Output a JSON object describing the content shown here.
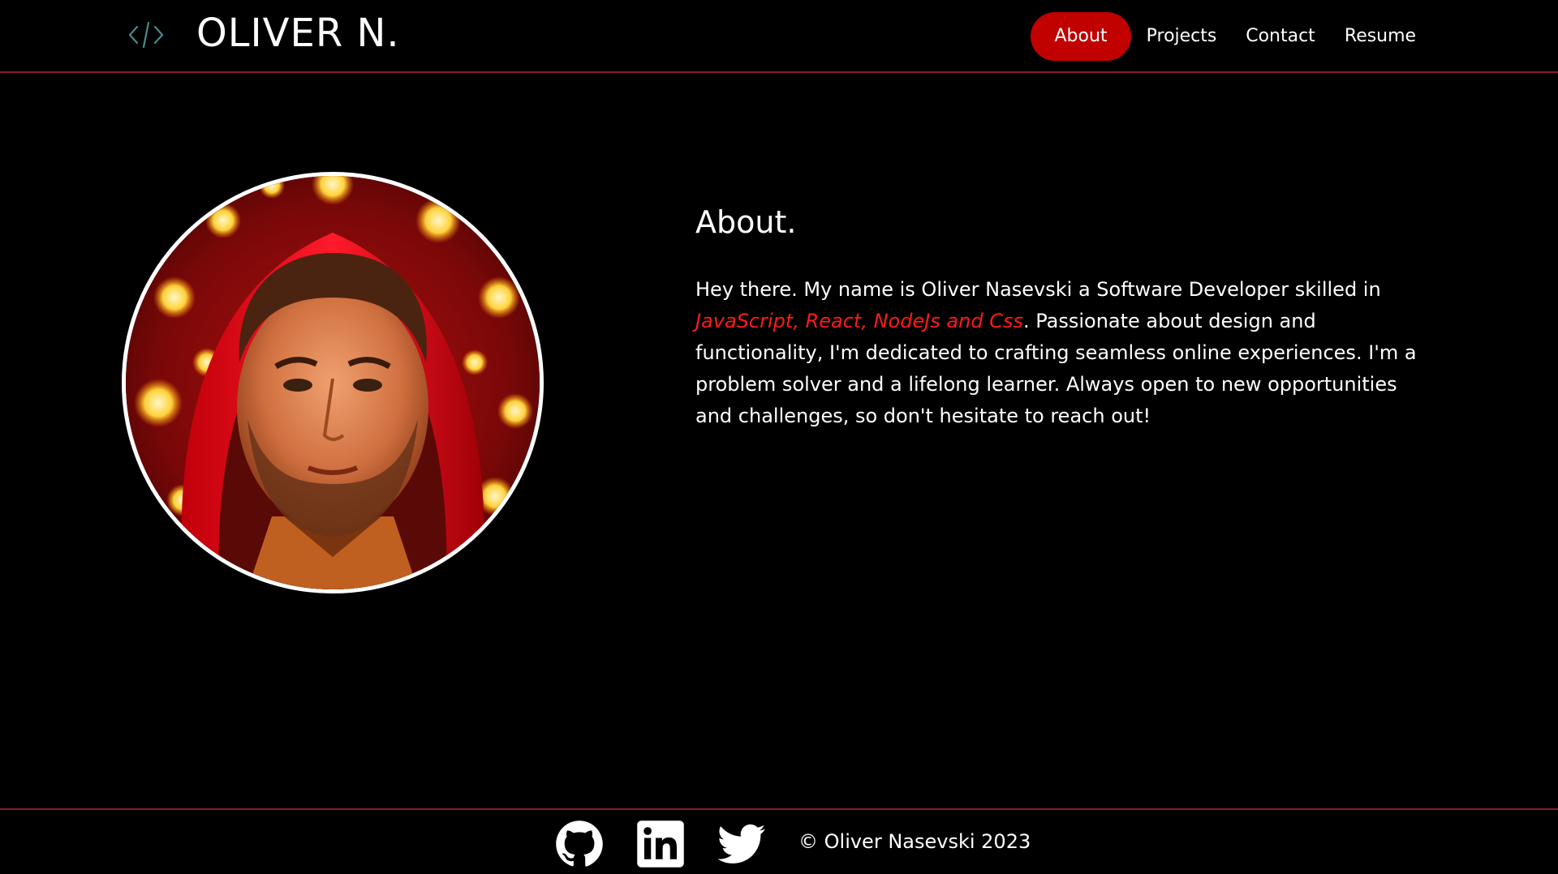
{
  "header": {
    "logo_icon": "code-brackets-icon",
    "logo_text": "OLIVER N.",
    "nav": [
      {
        "label": "About",
        "active": true
      },
      {
        "label": "Projects",
        "active": false
      },
      {
        "label": "Contact",
        "active": false
      },
      {
        "label": "Resume",
        "active": false
      }
    ]
  },
  "about": {
    "title": "About.",
    "intro": "Hey there. My name is Oliver Nasevski a Software Developer skilled in ",
    "skills": "JavaScript, React, NodeJs and Css",
    "rest": ". Passionate about design and functionality, I'm dedicated to crafting seamless online experiences. I'm a problem solver and a lifelong learner. Always open to new opportunities and challenges, so don't hesitate to reach out!"
  },
  "footer": {
    "social": [
      {
        "name": "github-icon"
      },
      {
        "name": "linkedin-icon"
      },
      {
        "name": "twitter-icon"
      }
    ],
    "copyright": "© Oliver Nasevski 2023"
  },
  "colors": {
    "background": "#000000",
    "accent": "#c10000",
    "skills_text": "#ff1a1a",
    "divider": "#8a1a2a",
    "text": "#ffffff"
  }
}
